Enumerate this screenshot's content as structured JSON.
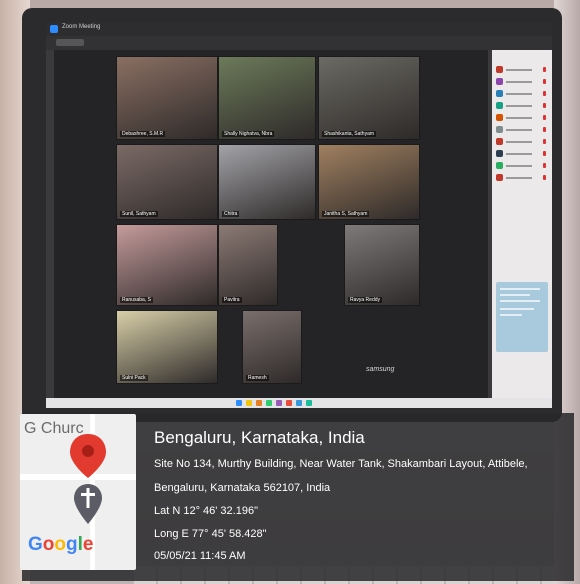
{
  "screen": {
    "window_title": "Zoom Meeting",
    "device_label": "samsung",
    "tiles": [
      {
        "name": "Debashree, S.M.R",
        "color": "#8a6f63"
      },
      {
        "name": "Shally Nighatva, Nbra",
        "color": "#6c7a5a"
      },
      {
        "name": "Shashikanta, Sathyam",
        "color": "#6b6a63"
      },
      {
        "name": "Sunil, Sathyam",
        "color": "#7b6a66"
      },
      {
        "name": "Chitra",
        "color": "#a3a3a8"
      },
      {
        "name": "Janitha S, Sathyam",
        "color": "#a08060"
      },
      {
        "name": "Ranusaba, S",
        "color": "#c59b9b"
      },
      {
        "name": "Pavitra",
        "color": "#8c7a74"
      },
      {
        "name": "Ravya Reddy",
        "color": "#7d7a79"
      },
      {
        "name": "Sulni Pack",
        "color": "#d8cfa8"
      },
      {
        "name": "Ramesh",
        "color": "#7a6e6c"
      }
    ],
    "participant_avatar_colors": [
      "#c0392b",
      "#8e44ad",
      "#2980b9",
      "#16a085",
      "#d35400",
      "#7f8c8d",
      "#c0392b",
      "#2c3e50",
      "#27ae60",
      "#c0392b"
    ],
    "taskbar_icon_colors": [
      "#2d8cff",
      "#f1c40f",
      "#e67e22",
      "#2ecc71",
      "#9b59b6",
      "#e74c3c",
      "#3498db",
      "#1abc9c"
    ]
  },
  "geotag": {
    "map_label": "G Churc",
    "google_word": "Google",
    "title": "Bengaluru, Karnataka, India",
    "address_line1": "Site No 134, Murthy Building, Near Water Tank, Shakambari Layout, Attibele,",
    "address_line2": "Bengaluru, Karnataka 562107, India",
    "latitude": "Lat N 12° 46' 32.196\"",
    "longitude": "Long E 77° 45' 58.428\"",
    "datetime": "05/05/21 11:45 AM",
    "pin_color": "#e23a2e",
    "cross_color": "#5c5c66"
  }
}
